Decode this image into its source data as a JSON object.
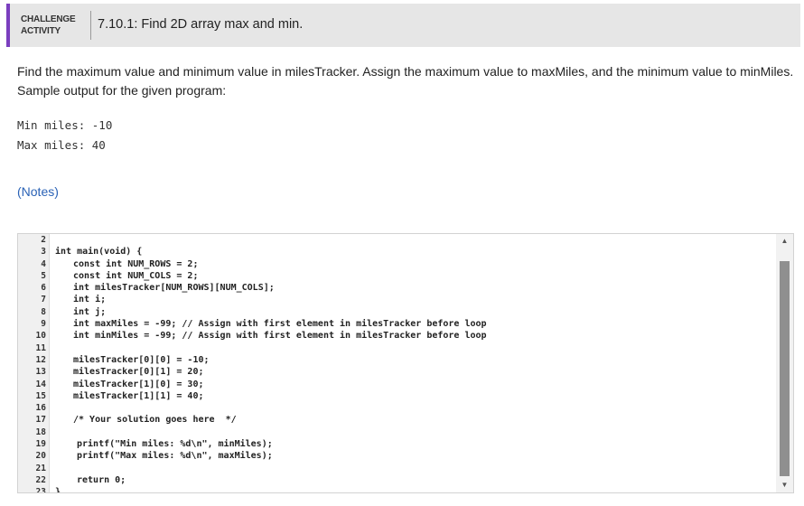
{
  "header": {
    "badge_line1": "CHALLENGE",
    "badge_line2": "ACTIVITY",
    "title": "7.10.1: Find 2D array max and min."
  },
  "instructions": "Find the maximum value and minimum value in milesTracker. Assign the maximum value to maxMiles, and the minimum value to minMiles. Sample output for the given program:",
  "sample_output": [
    "Min miles: -10",
    "Max miles: 40"
  ],
  "notes_link": "(Notes)",
  "code_lines": [
    {
      "n": "2",
      "text": ""
    },
    {
      "n": "3",
      "text": "int main(void) {"
    },
    {
      "n": "4",
      "text": "const int NUM_ROWS = 2;"
    },
    {
      "n": "5",
      "text": "const int NUM_COLS = 2;"
    },
    {
      "n": "6",
      "text": "int milesTracker[NUM_ROWS][NUM_COLS];"
    },
    {
      "n": "7",
      "text": "int i;"
    },
    {
      "n": "8",
      "text": "int j;"
    },
    {
      "n": "9",
      "text": "int maxMiles = -99; // Assign with first element in milesTracker before loop"
    },
    {
      "n": "10",
      "text": "int minMiles = -99; // Assign with first element in milesTracker before loop"
    },
    {
      "n": "11",
      "text": ""
    },
    {
      "n": "12",
      "text": "milesTracker[0][0] = -10;"
    },
    {
      "n": "13",
      "text": "milesTracker[0][1] = 20;"
    },
    {
      "n": "14",
      "text": "milesTracker[1][0] = 30;"
    },
    {
      "n": "15",
      "text": "milesTracker[1][1] = 40;"
    },
    {
      "n": "16",
      "text": ""
    },
    {
      "n": "17",
      "text": "/* Your solution goes here  */"
    },
    {
      "n": "18",
      "text": ""
    },
    {
      "n": "19",
      "text": "printf(\"Min miles: %d\\n\", minMiles);"
    },
    {
      "n": "20",
      "text": "printf(\"Max miles: %d\\n\", maxMiles);"
    },
    {
      "n": "21",
      "text": ""
    },
    {
      "n": "22",
      "text": "return 0;"
    },
    {
      "n": "23",
      "text": "}"
    }
  ],
  "icons": {
    "scroll_up": "triangle-up",
    "scroll_down": "triangle-down"
  }
}
